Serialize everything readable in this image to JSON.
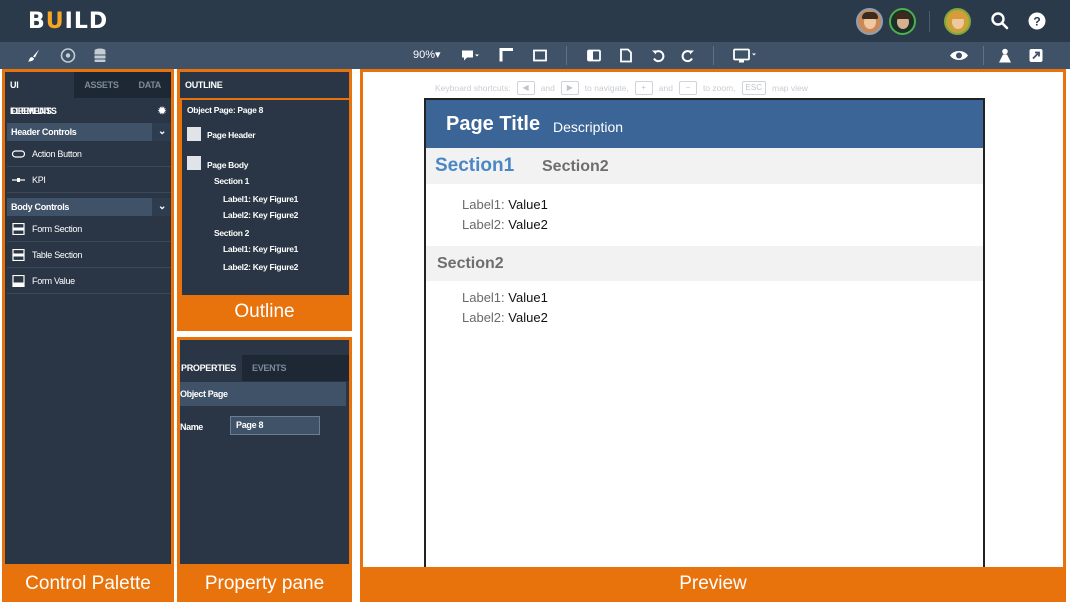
{
  "app": {
    "logo_prefix": "B",
    "logo_accent": "U",
    "logo_suffix": "ILD"
  },
  "header": {
    "icons": [
      "avatar-1",
      "avatar-2",
      "avatar-3",
      "search-icon",
      "help-icon"
    ]
  },
  "toolbar": {
    "zoom": "90%▾"
  },
  "control_palette": {
    "tabs": [
      "UI ELEMENTS",
      "ASSETS",
      "DATA"
    ],
    "open_uis": "OPEN UIS",
    "groups": [
      {
        "label": "Header Controls",
        "items": [
          "Action Button",
          "KPI"
        ]
      },
      {
        "label": "Body Controls",
        "items": [
          "Form Section",
          "Table Section",
          "Form Value"
        ]
      }
    ],
    "label": "Control Palette"
  },
  "outline": {
    "tab": "OUTLINE",
    "root": "Object Page: Page 8",
    "page_header": "Page Header",
    "page_body": "Page Body",
    "section1": "Section 1",
    "s1_label1": "Label1: Key Figure1",
    "s1_label2": "Label2: Key Figure2",
    "section2": "Section 2",
    "s2_label1": "Label1: Key Figure1",
    "s2_label2": "Label2: Key Figure2",
    "label": "Outline"
  },
  "properties": {
    "tabs": [
      "PROPERTIES",
      "EVENTS"
    ],
    "object": "Object Page",
    "name_label": "Name",
    "name_value": "Page 8",
    "label": "Property pane"
  },
  "preview": {
    "shortcuts": {
      "prefix": "Keyboard shortcuts:",
      "and1": "and",
      "navigate": "to navigate,",
      "and2": "and",
      "zoom": "to zoom,",
      "esc": "ESC",
      "map": "map view"
    },
    "page_title": "Page Title",
    "description": "Description",
    "tab_section1": "Section1",
    "tab_section2": "Section2",
    "section1": {
      "label1": "Label1:",
      "value1": "Value1",
      "label2": "Label2:",
      "value2": "Value2"
    },
    "section2_title": "Section2",
    "section2": {
      "label1": "Label1:",
      "value1": "Value1",
      "label2": "Label2:",
      "value2": "Value2"
    },
    "label": "Preview"
  },
  "colors": {
    "accent": "#e8730c",
    "header_bg": "#2b3a4a",
    "panel_bg": "#2a3645",
    "preview_header": "#3a6596",
    "section_link": "#4a87c5"
  }
}
